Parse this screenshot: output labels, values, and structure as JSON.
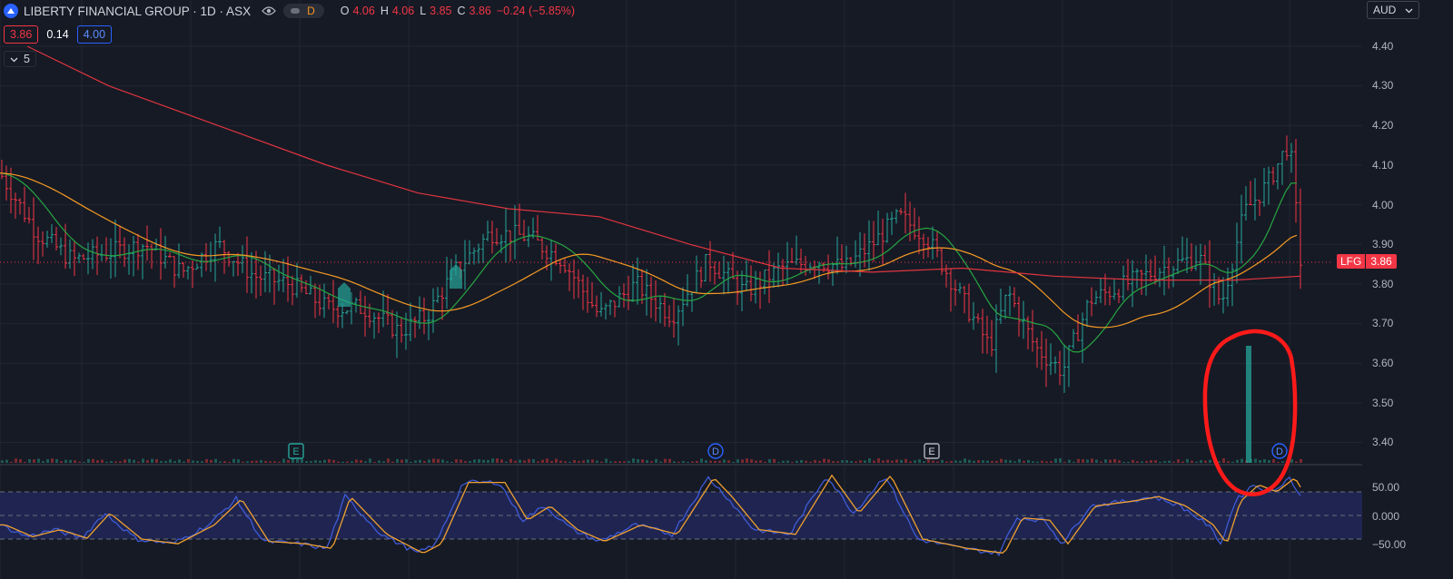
{
  "header": {
    "title": "LIBERTY FINANCIAL GROUP · 1D · ASX",
    "interval_badge": "D",
    "ohlc": [
      {
        "k": "O",
        "v": "4.06"
      },
      {
        "k": "H",
        "v": "4.06"
      },
      {
        "k": "L",
        "v": "3.85"
      },
      {
        "k": "C",
        "v": "3.86"
      },
      {
        "k": "",
        "v": "−0.24 (−5.85%)"
      }
    ]
  },
  "quote": {
    "bid": "3.86",
    "spread": "0.14",
    "ask": "4.00"
  },
  "indicators": {
    "count_label": "5"
  },
  "currency": "AUD",
  "price_axis": [
    "4.40",
    "4.30",
    "4.20",
    "4.10",
    "4.00",
    "3.90",
    "3.80",
    "3.70",
    "3.60",
    "3.50",
    "3.40"
  ],
  "osc_axis": [
    "50.00",
    "0.000",
    "−50.00"
  ],
  "last_price": {
    "symbol": "LFG",
    "value": "3.86"
  },
  "events": [
    {
      "label": "E",
      "kind": "earnings"
    },
    {
      "label": "D",
      "kind": "dividend"
    },
    {
      "label": "E",
      "kind": "earnings"
    },
    {
      "label": "D",
      "kind": "dividend"
    }
  ],
  "colors": {
    "background": "#161a25",
    "grid": "#232733",
    "up": "#26a69a",
    "down": "#f23645",
    "ma_fast": "#26a642",
    "ma_mid": "#f59a23",
    "ma_slow": "#e0353f",
    "osc_fast": "#3f5bd8",
    "osc_slow": "#f0a030",
    "annotation": "#ff1a1a"
  },
  "icons": [
    "logo-icon",
    "eye-icon",
    "chevron-down-icon"
  ]
}
